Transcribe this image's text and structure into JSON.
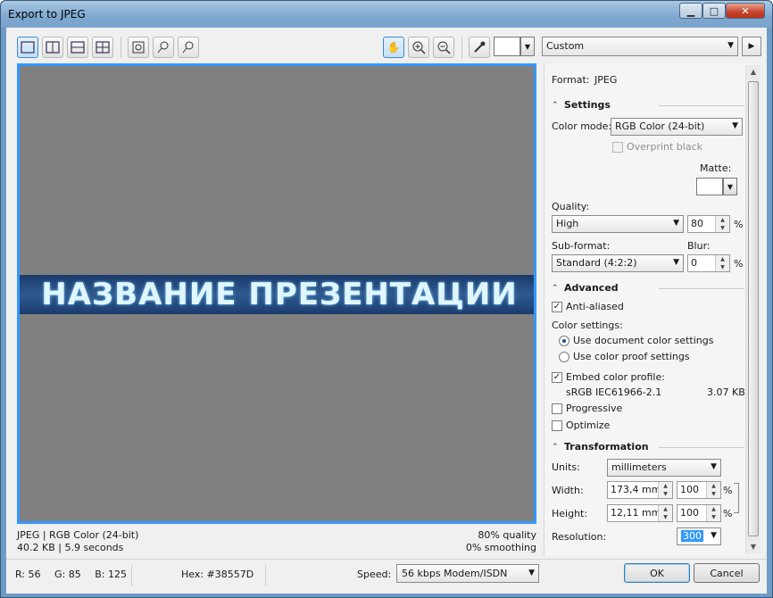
{
  "window": {
    "title": "Export to JPEG",
    "min_glyph": "▁",
    "max_glyph": "□",
    "close_glyph": "✕"
  },
  "toolbar": {
    "preset": "Custom",
    "icons": [
      "single-view-icon",
      "split-vertical-icon",
      "split-horizontal-icon",
      "quad-view-icon",
      "zoom-fit-icon",
      "zoom-1to1-icon",
      "zoom-100-icon",
      "pan-hand-icon",
      "zoom-in-icon",
      "zoom-out-icon",
      "eyedropper-icon"
    ]
  },
  "preview": {
    "banner_text": "НАЗВАНИЕ ПРЕЗЕНТАЦИИ",
    "status_left_line1": "JPEG  |  RGB Color (24-bit)",
    "status_left_line2": "40.2 KB  |  5.9 seconds",
    "status_right_line1": "80% quality",
    "status_right_line2": "0% smoothing"
  },
  "panel": {
    "format_label": "Format:",
    "format_value": "JPEG",
    "settings": {
      "heading": "Settings",
      "color_mode_label": "Color mode:",
      "color_mode_value": "RGB Color (24-bit)",
      "overprint_label": "Overprint black",
      "matte_label": "Matte:",
      "quality_label": "Quality:",
      "quality_value": "High",
      "quality_num": "80",
      "sub_format_label": "Sub-format:",
      "sub_format_value": "Standard (4:2:2)",
      "blur_label": "Blur:",
      "blur_value": "0",
      "percent": "%"
    },
    "advanced": {
      "heading": "Advanced",
      "anti_aliased_label": "Anti-aliased",
      "color_settings_label": "Color settings:",
      "use_document_label": "Use document color settings",
      "use_proof_label": "Use color proof settings",
      "embed_profile_label": "Embed color profile:",
      "profile_name": "sRGB IEC61966-2.1",
      "profile_size": "3.07 KB",
      "progressive_label": "Progressive",
      "optimize_label": "Optimize"
    },
    "transformation": {
      "heading": "Transformation",
      "units_label": "Units:",
      "units_value": "millimeters",
      "width_label": "Width:",
      "width_value": "173,4 mm",
      "width_pct": "100",
      "height_label": "Height:",
      "height_value": "12,11 mm",
      "height_pct": "100",
      "resolution_label": "Resolution:",
      "resolution_value": "300"
    }
  },
  "footer": {
    "r": "R: 56",
    "g": "G: 85",
    "b": "B: 125",
    "hex": "Hex: #38557D",
    "speed_label": "Speed:",
    "speed_value": "56 kbps Modem/ISDN",
    "ok_label": "OK",
    "cancel_label": "Cancel"
  },
  "colors": {
    "accent": "#3399ff",
    "preview_bg": "#808080",
    "banner": "#2f5a8f"
  }
}
